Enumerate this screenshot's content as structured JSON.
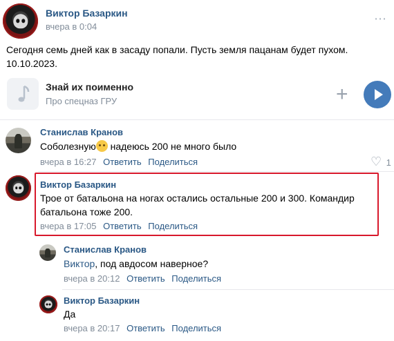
{
  "post": {
    "author": "Виктор Базаркин",
    "time": "вчера в 0:04",
    "text": "Сегодня семь дней как в засаду попали. Пусть земля пацанам будет пухом. 10.10.2023.",
    "options_icon": "⋯",
    "audio": {
      "title": "Знай их поименно",
      "artist": "Про спецназ ГРУ",
      "add_icon": "+"
    }
  },
  "comments": [
    {
      "author": "Станислав Кранов",
      "text_before": "Соболезную",
      "emoji": "disappointed-face-icon",
      "text_after": " надеюсь 200 не много было",
      "time": "вчера в 16:27",
      "reply": "Ответить",
      "share": "Поделиться",
      "likes": "1"
    },
    {
      "author": "Виктор Базаркин",
      "text": "Трое от батальона на ногах остались остальные 200 и 300. Командир батальона тоже 200.",
      "time": "вчера в 17:05",
      "reply": "Ответить",
      "share": "Поделиться",
      "highlighted": true,
      "highlight_color": "#d8182b"
    }
  ],
  "replies": [
    {
      "author": "Станислав Кранов",
      "mention": "Виктор",
      "text": ", под авдосом наверное?",
      "time": "вчера в 20:12",
      "reply": "Ответить",
      "share": "Поделиться"
    },
    {
      "author": "Виктор Базаркин",
      "text": "Да",
      "time": "вчера в 20:17",
      "reply": "Ответить",
      "share": "Поделиться"
    }
  ],
  "colors": {
    "link": "#2a5885",
    "meta": "#818c99",
    "play": "#447bba"
  }
}
